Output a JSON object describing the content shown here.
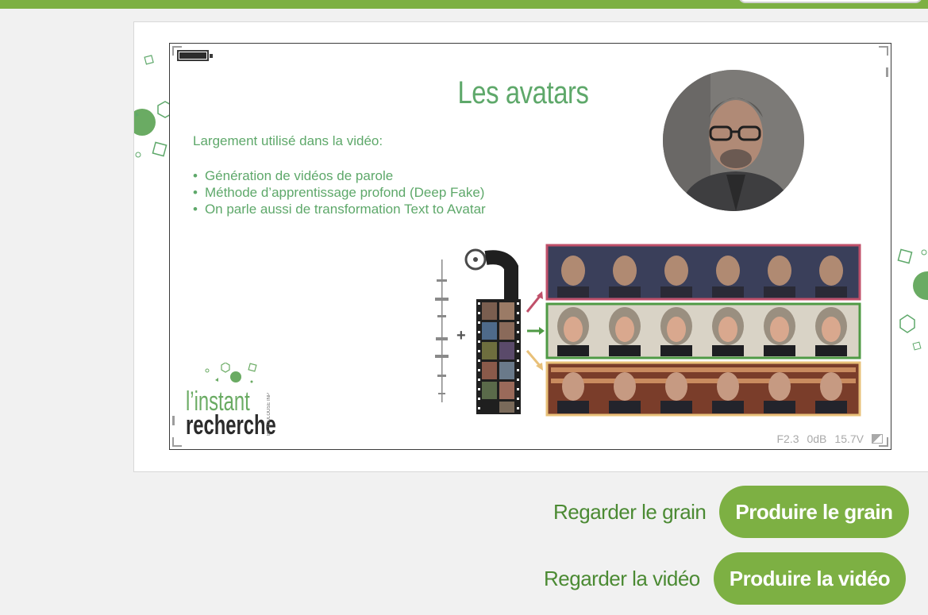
{
  "slide": {
    "title": "Les avatars",
    "intro": "Largement utilisé dans la vidéo:",
    "bullets": [
      "Génération de vidéos de parole",
      "Méthode d’apprentissage profond  (Deep Fake)",
      "On parle aussi de transformation Text to Avatar"
    ],
    "logo_line1": "l’instant",
    "logo_line2": "recherche",
    "logo_tagline": "BY TOULOUSE INP",
    "camera": {
      "aperture": "F2.3",
      "gain": "0dB",
      "voltage": "15.7V"
    }
  },
  "actions": {
    "watch_grain": "Regarder le grain",
    "produce_grain": "Produire le grain",
    "watch_video": "Regarder la vidéo",
    "produce_video": "Produire la vidéo"
  },
  "icons": {
    "battery": "battery-icon",
    "exposure": "exposure-icon",
    "film": "film-reel-icon",
    "waveform": "audio-waveform-icon"
  },
  "colors": {
    "brand_green": "#7db043",
    "text_green": "#5ea86a",
    "link_green": "#4b8a33",
    "row_red": "#c0506a",
    "row_green": "#4f9a45",
    "row_yellow": "#e8c079"
  }
}
